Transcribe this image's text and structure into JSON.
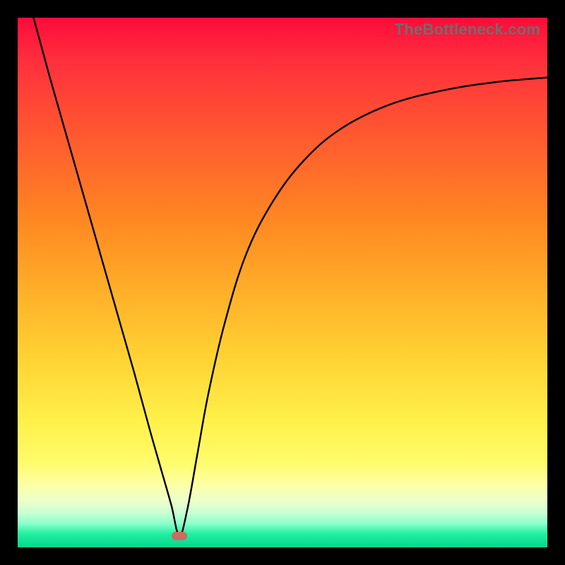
{
  "watermark": "TheBottleneck.com",
  "chart_data": {
    "type": "line",
    "title": "",
    "xlabel": "",
    "ylabel": "",
    "xlim": [
      0,
      100
    ],
    "ylim": [
      0,
      100
    ],
    "series": [
      {
        "name": "curve",
        "x": [
          3,
          6,
          10,
          14,
          18,
          22,
          25,
          27,
          29,
          30.5,
          32,
          34,
          36,
          39,
          43,
          48,
          54,
          61,
          70,
          80,
          90,
          100
        ],
        "y": [
          100,
          89,
          75,
          61,
          47,
          33,
          22,
          15,
          8,
          2.2,
          7,
          18,
          29,
          42,
          55,
          65,
          73,
          79,
          83.5,
          86.2,
          87.8,
          88.7
        ]
      }
    ],
    "marker": {
      "x": 30.5,
      "y": 2.2
    },
    "gradient_colors": {
      "top": "#ff0a3a",
      "mid": "#ffd233",
      "bottom": "#06d58e"
    }
  }
}
